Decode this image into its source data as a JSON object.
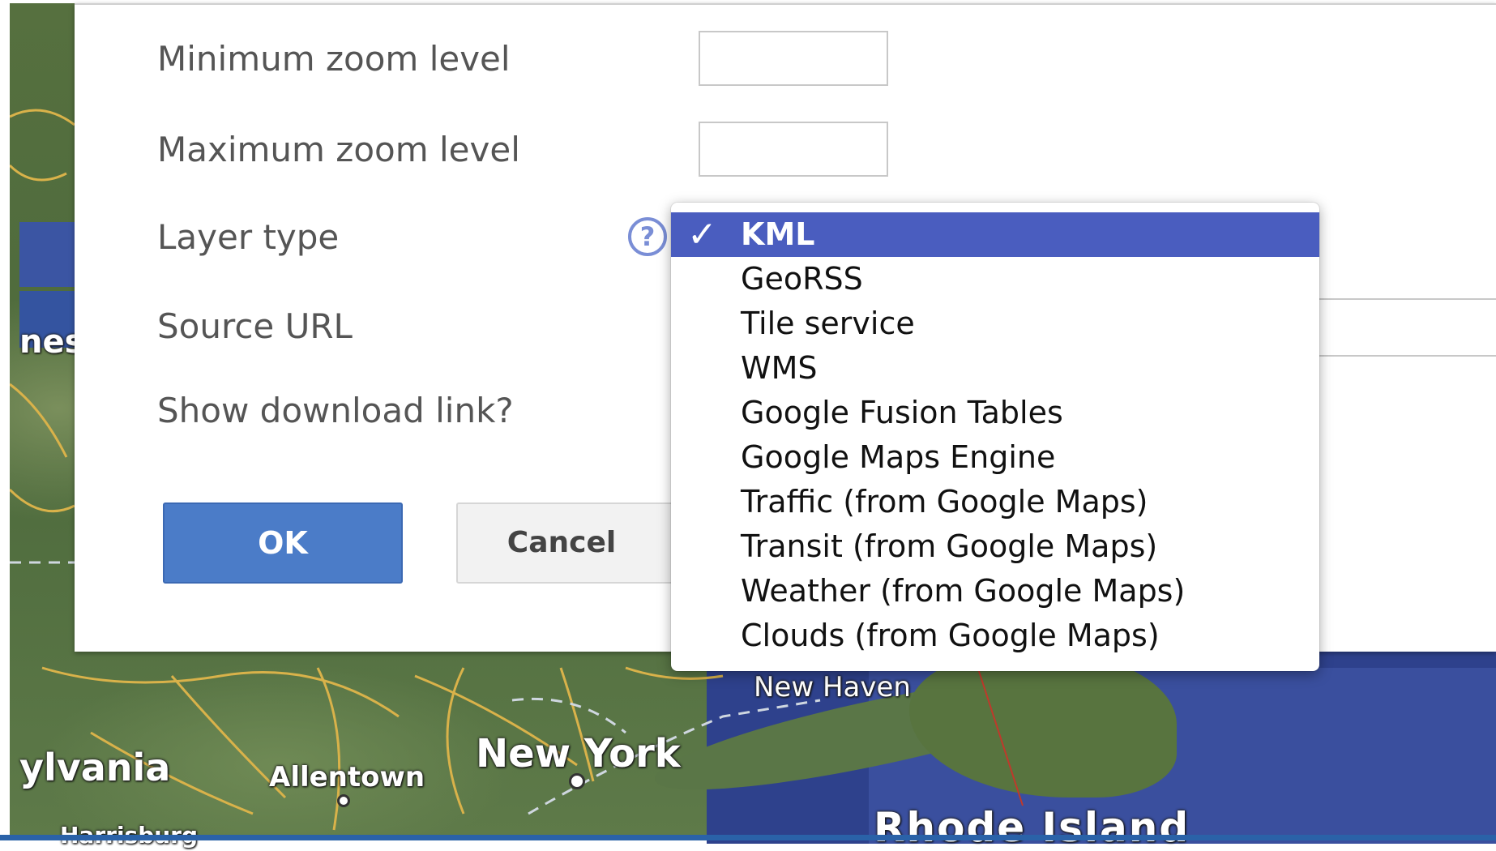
{
  "form": {
    "min_zoom_label": "Minimum zoom level",
    "min_zoom_value": "",
    "max_zoom_label": "Maximum zoom level",
    "max_zoom_value": "",
    "layer_type_label": "Layer type",
    "source_url_label": "Source URL",
    "source_url_value": "",
    "show_download_label": "Show download link?",
    "help_icon": "?"
  },
  "buttons": {
    "ok": "OK",
    "cancel": "Cancel"
  },
  "dropdown": {
    "selected": "KML",
    "check_icon": "✓",
    "options": [
      "KML",
      "GeoRSS",
      "Tile service",
      "WMS",
      "Google Fusion Tables",
      "Google Maps Engine",
      "Traffic (from Google Maps)",
      "Transit (from Google Maps)",
      "Weather (from Google Maps)",
      "Clouds (from Google Maps)"
    ]
  },
  "map_labels": {
    "new_haven": "New Haven",
    "new_york": "New York",
    "ylvania": "ylvania",
    "allentown": "Allentown",
    "harrisburg": "Harrisburg",
    "rhode_island": "Rhode Island",
    "west": "nest"
  },
  "colors": {
    "ok_button": "#4b7cc8",
    "selected_option": "#4a5dbf",
    "sea": "#2e418c",
    "land": "#56703f"
  }
}
